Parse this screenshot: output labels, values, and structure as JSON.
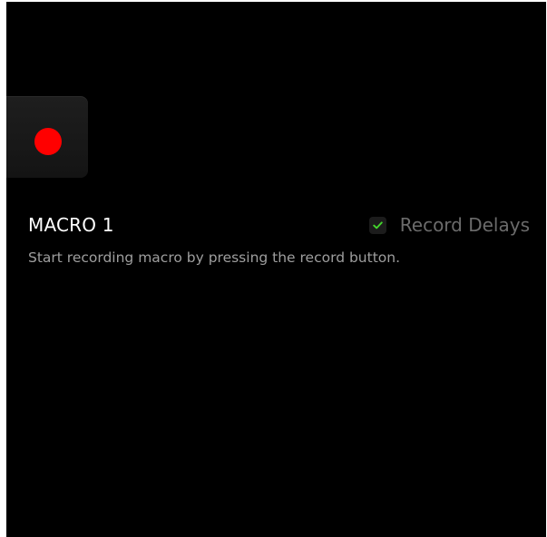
{
  "macro": {
    "title": "MACRO 1",
    "instruction": "Start recording macro by pressing the record button."
  },
  "record_delays": {
    "label": "Record Delays",
    "checked": true
  },
  "colors": {
    "background": "#000000",
    "record_dot": "#ff0000",
    "check_accent": "#44d62c"
  },
  "icons": {
    "record": "record-dot-icon",
    "check": "checkmark-icon"
  }
}
